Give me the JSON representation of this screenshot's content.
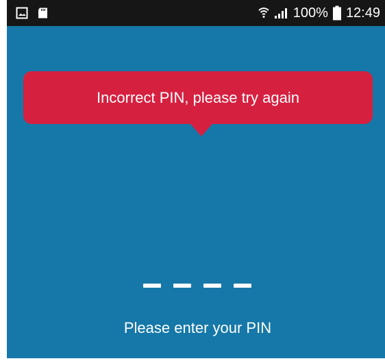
{
  "status_bar": {
    "left_icons": [
      "gallery-icon",
      "sd-card-icon"
    ],
    "right_icons": [
      "wifi-icon",
      "signal-icon",
      "battery-icon"
    ],
    "battery_percent": "100%",
    "time": "12:49"
  },
  "alert": {
    "message": "Incorrect PIN, please try again",
    "color": "#d62040"
  },
  "pin": {
    "digits_entered": 0,
    "slots": 4
  },
  "prompt": {
    "text": "Please enter your PIN"
  },
  "colors": {
    "background": "#1678a8",
    "status_bar": "#161616",
    "text": "#ffffff"
  }
}
